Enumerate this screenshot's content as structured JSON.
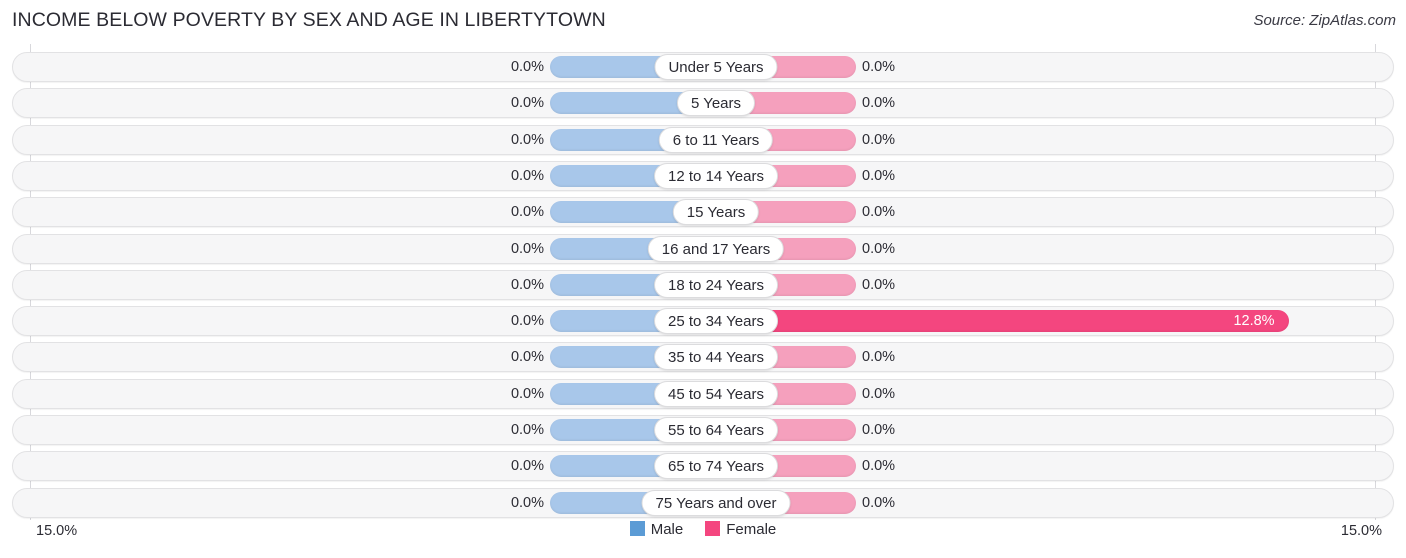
{
  "header": {
    "title": "INCOME BELOW POVERTY BY SEX AND AGE IN LIBERTYTOWN",
    "source": "Source: ZipAtlas.com"
  },
  "axis": {
    "left_label": "15.0%",
    "right_label": "15.0%"
  },
  "legend": {
    "items": [
      {
        "label": "Male",
        "color": "#5b9bd5"
      },
      {
        "label": "Female",
        "color": "#f4467f"
      }
    ]
  },
  "colors": {
    "male_bar": "#a8c7ea",
    "female_bar_zero": "#f5a0bd",
    "female_bar_value": "#f4467f",
    "male_legend": "#5b9bd5",
    "female_legend": "#f4467f",
    "row_background": "#f6f6f7",
    "row_border": "#e2e2e4",
    "gridline": "#d8d8dc",
    "text": "#2b2b33"
  },
  "chart_data": {
    "type": "bar",
    "title": "INCOME BELOW POVERTY BY SEX AND AGE IN LIBERTYTOWN",
    "xlabel": "",
    "ylabel": "",
    "orientation": "horizontal-diverging",
    "axis_max_percent": 15.0,
    "grid": true,
    "legend_position": "bottom-center",
    "categories": [
      "Under 5 Years",
      "5 Years",
      "6 to 11 Years",
      "12 to 14 Years",
      "15 Years",
      "16 and 17 Years",
      "18 to 24 Years",
      "25 to 34 Years",
      "35 to 44 Years",
      "45 to 54 Years",
      "55 to 64 Years",
      "65 to 74 Years",
      "75 Years and over"
    ],
    "series": [
      {
        "name": "Male",
        "values": [
          0.0,
          0.0,
          0.0,
          0.0,
          0.0,
          0.0,
          0.0,
          0.0,
          0.0,
          0.0,
          0.0,
          0.0,
          0.0
        ],
        "labels": [
          "0.0%",
          "0.0%",
          "0.0%",
          "0.0%",
          "0.0%",
          "0.0%",
          "0.0%",
          "0.0%",
          "0.0%",
          "0.0%",
          "0.0%",
          "0.0%",
          "0.0%"
        ]
      },
      {
        "name": "Female",
        "values": [
          0.0,
          0.0,
          0.0,
          0.0,
          0.0,
          0.0,
          0.0,
          12.8,
          0.0,
          0.0,
          0.0,
          0.0,
          0.0
        ],
        "labels": [
          "0.0%",
          "0.0%",
          "0.0%",
          "0.0%",
          "0.0%",
          "0.0%",
          "0.0%",
          "12.8%",
          "0.0%",
          "0.0%",
          "0.0%",
          "0.0%",
          "0.0%"
        ]
      }
    ]
  }
}
